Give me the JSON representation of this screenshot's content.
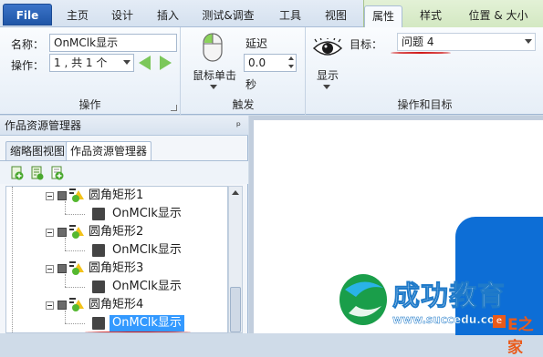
{
  "tabs": {
    "file": "File",
    "items": [
      "主页",
      "设计",
      "插入",
      "测试&调查",
      "工具",
      "视图"
    ],
    "context_items": [
      "属性",
      "样式",
      "位置 & 大小"
    ]
  },
  "ribbon": {
    "operation": {
      "name_label": "名称：",
      "name_value": "OnMClk显示",
      "op_label": "操作：",
      "op_value": "1 , 共 1 个",
      "group_label": "操作"
    },
    "trigger": {
      "mouse_label": "鼠标单击",
      "delay_label": "延迟",
      "delay_value": "0.0",
      "unit": "秒",
      "group_label": "触发"
    },
    "target": {
      "show_label": "显示",
      "target_label": "目标：",
      "target_value": "问题 4",
      "group_label": "操作和目标"
    }
  },
  "pane": {
    "title": "作品资源管理器",
    "pin": "ᵖ",
    "tabs": [
      "缩略图视图",
      "作品资源管理器"
    ],
    "tree": [
      {
        "label": "圆角矩形1",
        "type": "shape"
      },
      {
        "label": "OnMClk显示",
        "type": "action"
      },
      {
        "label": "圆角矩形2",
        "type": "shape"
      },
      {
        "label": "OnMClk显示",
        "type": "action"
      },
      {
        "label": "圆角矩形3",
        "type": "shape"
      },
      {
        "label": "OnMClk显示",
        "type": "action"
      },
      {
        "label": "圆角矩形4",
        "type": "shape"
      },
      {
        "label": "OnMClk显示",
        "type": "action",
        "selected": true
      }
    ]
  },
  "watermark": {
    "text": "成功教育",
    "url": "www.succedu.com",
    "brand": "E之家"
  },
  "colors": {
    "accent_red": "#d11a1a",
    "selection": "#3399ff",
    "slide_blue": "#0d6ed6",
    "file_tab": "#2a62b8"
  }
}
